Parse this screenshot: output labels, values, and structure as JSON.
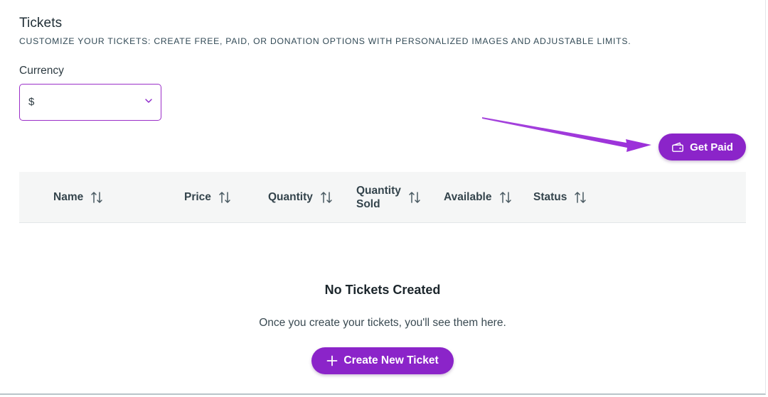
{
  "section": {
    "title": "Tickets",
    "subtitle": "CUSTOMIZE YOUR TICKETS: CREATE FREE, PAID, OR DONATION OPTIONS WITH PERSONALIZED IMAGES AND ADJUSTABLE LIMITS."
  },
  "currency": {
    "label": "Currency",
    "value": "$"
  },
  "actions": {
    "get_paid_label": "Get Paid",
    "create_ticket_label": "Create New Ticket"
  },
  "table": {
    "columns": [
      {
        "line1": "Name",
        "line2": ""
      },
      {
        "line1": "Price",
        "line2": ""
      },
      {
        "line1": "Quantity",
        "line2": ""
      },
      {
        "line1": "Quantity",
        "line2": "Sold"
      },
      {
        "line1": "Available",
        "line2": ""
      },
      {
        "line1": "Status",
        "line2": ""
      }
    ]
  },
  "empty_state": {
    "title": "No Tickets Created",
    "message": "Once you create your tickets, you'll see them here."
  },
  "colors": {
    "accent": "#8b24c9",
    "annotation_arrow": "#9b2fd9",
    "select_border": "#9b2fc8",
    "header_bg": "#f5f6f6"
  },
  "icons": {
    "currency_dropdown": "chevron-down-icon",
    "get_paid": "wallet-icon",
    "create_ticket": "plus-icon",
    "sort": "sort-arrows-icon"
  }
}
